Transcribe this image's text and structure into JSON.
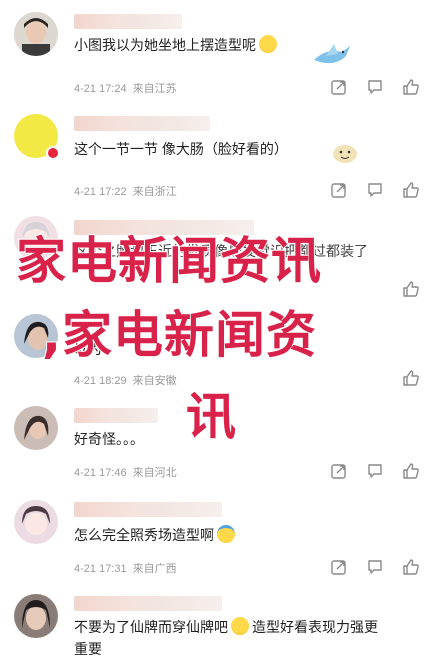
{
  "comments": [
    {
      "text": "小图我以为她坐地上摆造型呢",
      "emoji": "grin-emoji",
      "date": "4-21 17:24",
      "location": "来自江苏",
      "avatar_color": "#d9d4cc"
    },
    {
      "text": "这个一节一节  像大肠（脸好看的）",
      "emoji": "",
      "date": "4-21 17:22",
      "location": "来自浙江",
      "avatar_color": "#f2e94e"
    },
    {
      "text": "这个之照和玉近的发质像是发觉识把都过都装了",
      "emoji": "",
      "date": "",
      "location": "",
      "avatar_color": "#f3dbe2"
    },
    {
      "text": "以为",
      "emoji": "",
      "date": "4-21 18:29",
      "location": "来自安徽",
      "avatar_color": "#b9c6d6"
    },
    {
      "text": "好奇怪。。。",
      "emoji": "",
      "date": "4-21 17:46",
      "location": "来自河北",
      "avatar_color": "#c7b8b2"
    },
    {
      "text": "怎么完全照秀场造型啊",
      "emoji": "sweat-emoji",
      "date": "4-21 17:31",
      "location": "来自广西",
      "avatar_color": "#ead6de"
    },
    {
      "text": "不要为了仙牌而穿仙牌吧",
      "text_tail": "造型好看表现力强更",
      "text_line2": "重要",
      "emoji": "laugh-emoji",
      "date": "",
      "location": "",
      "avatar_color": "#8a7d78"
    }
  ],
  "overlay": {
    "line1": "家电新闻资讯",
    "line2": ",家电新闻资",
    "line3": "讯"
  },
  "colors": {
    "overlay_text": "#d9224a",
    "meta_text": "#9a9a9a",
    "body_text": "#1f1f1f"
  },
  "icons": [
    "share-icon",
    "comment-icon",
    "like-icon"
  ]
}
